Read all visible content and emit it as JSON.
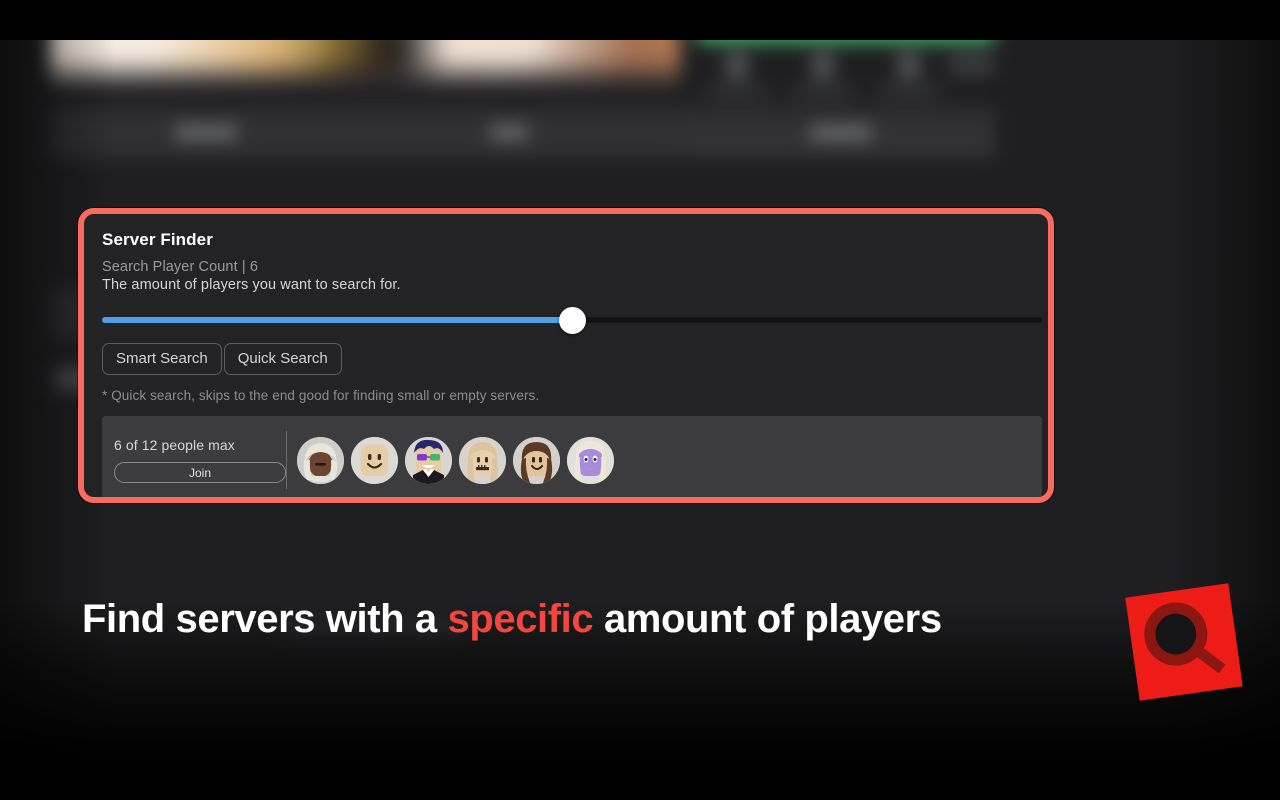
{
  "panel": {
    "title": "Server Finder",
    "subtitle": "Search Player Count | 6",
    "description": "The amount of players you want to search for.",
    "note": "* Quick search, skips to the end good for finding small or empty servers.",
    "accent_border_color": "#fb6a5e",
    "background_color": "#232325",
    "slider": {
      "value": 6,
      "min": 1,
      "max": 12,
      "fill_percent": 50,
      "fill_color": "#4d9fe8",
      "track_color": "#121214",
      "thumb_color": "#ffffff"
    },
    "buttons": [
      {
        "label": "Smart Search",
        "name": "smart-search-button"
      },
      {
        "label": "Quick Search",
        "name": "quick-search-button"
      }
    ],
    "server": {
      "capacity_label": "6 of 12 people max",
      "join_label": "Join",
      "card_color": "#3c3c3f",
      "avatars": [
        {
          "name": "avatar-white-hair-dark-skin",
          "skin": "#6b4432",
          "hair": "#e8e4dc",
          "hair_style": "long"
        },
        {
          "name": "avatar-classic-yellow-smile",
          "skin": "#e4c9a4",
          "hair": "none",
          "hair_style": "none"
        },
        {
          "name": "avatar-blue-hair-sunglasses",
          "skin": "#e7cba6",
          "hair": "#2a2a7e",
          "hair_style": "spiky"
        },
        {
          "name": "avatar-blonde-long-hair",
          "skin": "#e8cfae",
          "hair": "#ddc49e",
          "hair_style": "long"
        },
        {
          "name": "avatar-brown-hair-smile",
          "skin": "#e3c39c",
          "hair": "#5a3a25",
          "hair_style": "long"
        },
        {
          "name": "avatar-purple-face-blonde",
          "skin": "#a58cdd",
          "hair": "#efe7d6",
          "hair_style": "long"
        }
      ]
    }
  },
  "caption": {
    "before": "Find servers with a ",
    "highlight": "specific",
    "after": " amount of players",
    "highlight_color": "#f4463f"
  },
  "logo": {
    "name": "magnifier-logo",
    "square_color": "#ed1c16",
    "glass_color": "#8c1710",
    "rotation_deg": -8
  },
  "background": {
    "play_button_color": "#3fa968",
    "page_color": "#1f1f21"
  }
}
